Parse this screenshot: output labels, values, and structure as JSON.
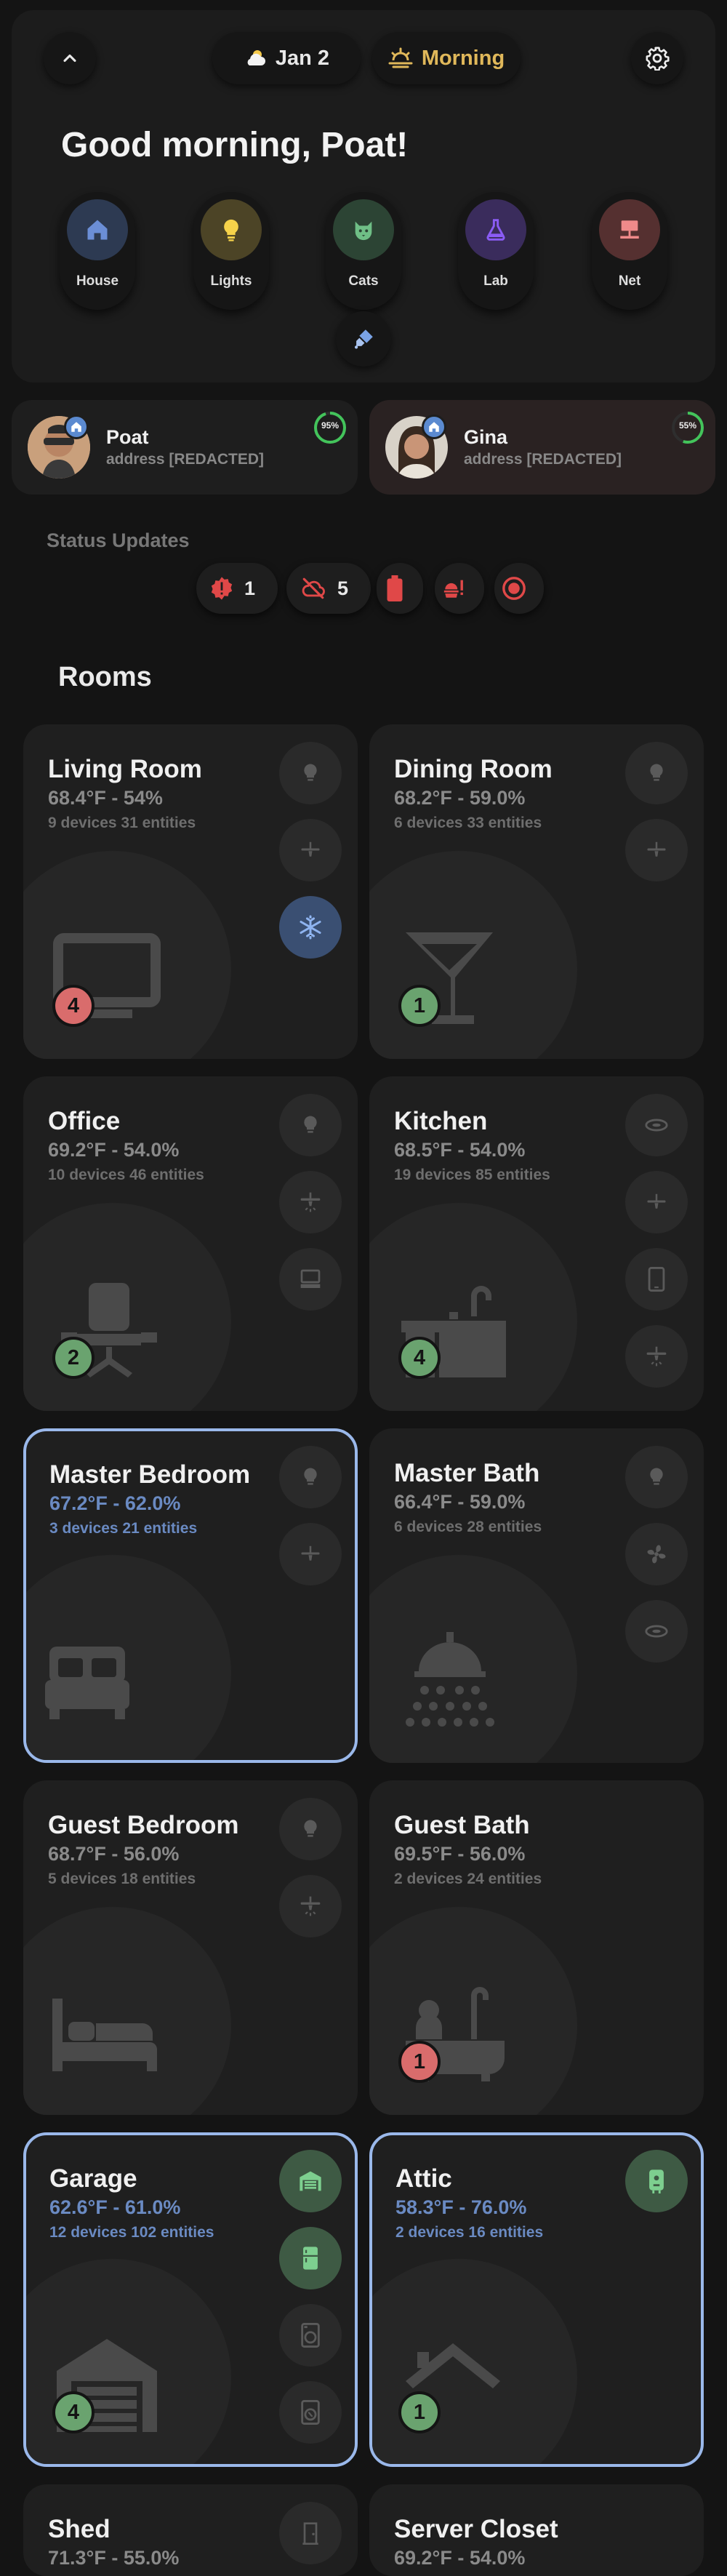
{
  "header": {
    "date": "Jan 2",
    "time_of_day": "Morning",
    "greeting": "Good morning, Poat!",
    "areas": [
      {
        "label": "House",
        "icon": "house-icon",
        "color": "#6b8ed6",
        "bg": "#2d3a52"
      },
      {
        "label": "Lights",
        "icon": "lightbulb-icon",
        "color": "#f5d24a",
        "bg": "#4c4426"
      },
      {
        "label": "Cats",
        "icon": "cat-icon",
        "color": "#6fbf86",
        "bg": "#2c4434"
      },
      {
        "label": "Lab",
        "icon": "flask-icon",
        "color": "#8b5cf6",
        "bg": "#3a2c5c"
      },
      {
        "label": "Net",
        "icon": "network-icon",
        "color": "#f08a8a",
        "bg": "#553030"
      }
    ]
  },
  "colors": {
    "accent_blue": "#9ab8ea",
    "time_gold": "#e0b85a",
    "alert_red": "#e04848",
    "battery_green": "#43c45b"
  },
  "people": [
    {
      "name": "Poat",
      "address": "address [REDACTED]",
      "battery": "95%"
    },
    {
      "name": "Gina",
      "address": "address [REDACTED]",
      "battery": "55%"
    }
  ],
  "status": {
    "title": "Status Updates",
    "chips": [
      {
        "icon": "alert-badge-icon",
        "count": "1"
      },
      {
        "icon": "cloud-off-icon",
        "count": "5"
      },
      {
        "icon": "battery-alert-icon",
        "count": ""
      },
      {
        "icon": "food-alert-icon",
        "count": ""
      },
      {
        "icon": "record-icon",
        "count": ""
      }
    ]
  },
  "rooms_title": "Rooms",
  "rooms": [
    {
      "name": "Living Room",
      "temp": "68.4°F - 54%",
      "devices": "9 devices 31 entities",
      "count": "4"
    },
    {
      "name": "Dining Room",
      "temp": "68.2°F - 59.0%",
      "devices": "6 devices 33 entities",
      "count": "1"
    },
    {
      "name": "Office",
      "temp": "69.2°F - 54.0%",
      "devices": "10 devices 46 entities",
      "count": "2"
    },
    {
      "name": "Kitchen",
      "temp": "68.5°F - 54.0%",
      "devices": "19 devices 85 entities",
      "count": "4"
    },
    {
      "name": "Master Bedroom",
      "temp": "67.2°F - 62.0%",
      "devices": "3 devices 21 entities",
      "count": ""
    },
    {
      "name": "Master Bath",
      "temp": "66.4°F - 59.0%",
      "devices": "6 devices 28 entities",
      "count": ""
    },
    {
      "name": "Guest Bedroom",
      "temp": "68.7°F - 56.0%",
      "devices": "5 devices 18 entities",
      "count": ""
    },
    {
      "name": "Guest Bath",
      "temp": "69.5°F - 56.0%",
      "devices": "2 devices 24 entities",
      "count": "1"
    },
    {
      "name": "Garage",
      "temp": "62.6°F - 61.0%",
      "devices": "12 devices 102 entities",
      "count": "4"
    },
    {
      "name": "Attic",
      "temp": "58.3°F - 76.0%",
      "devices": "2 devices 16 entities",
      "count": "1"
    },
    {
      "name": "Shed",
      "temp": "71.3°F - 55.0%",
      "devices": "",
      "count": ""
    },
    {
      "name": "Server Closet",
      "temp": "69.2°F - 54.0%",
      "devices": "",
      "count": ""
    }
  ]
}
